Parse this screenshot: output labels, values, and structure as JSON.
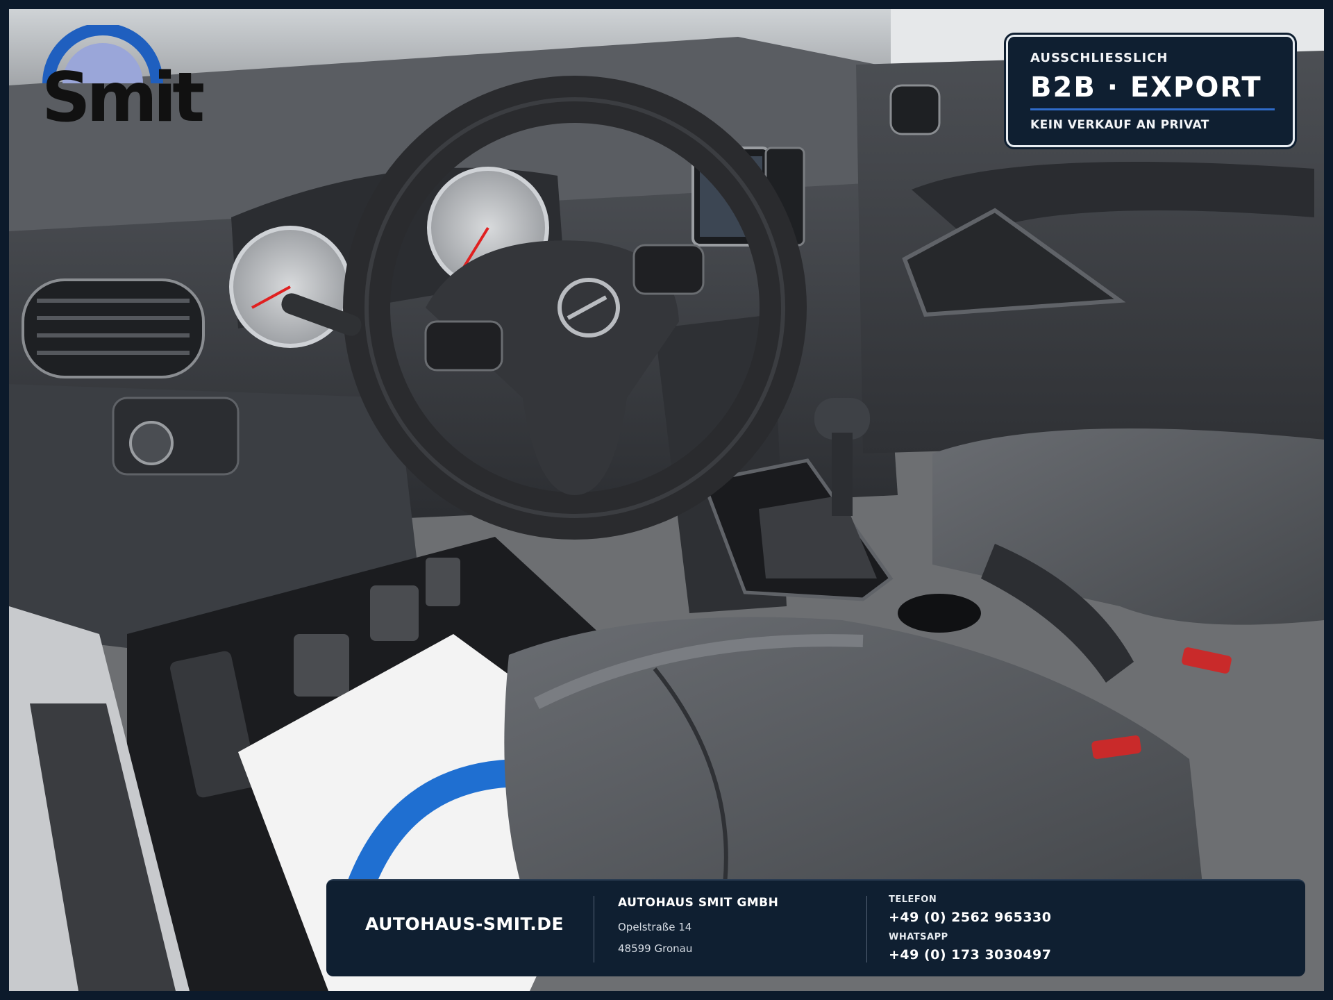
{
  "logo": {
    "text": "Smit",
    "arc_color": "#1f5fbf",
    "arc_inner_color": "#9aa6d9"
  },
  "badge": {
    "kicker": "AUSSCHLIESSLICH",
    "title": "B2B  ·  EXPORT",
    "subtitle": "KEIN VERKAUF AN PRIVAT",
    "accent": "#2f6bc8"
  },
  "footer": {
    "website": "AUTOHAUS-SMIT.DE",
    "company": "AUTOHAUS SMIT GMBH",
    "address_line1": "Opelstraße 14",
    "address_line2": "48599 Gronau",
    "phone_label": "TELEFON",
    "phone": "+49 (0) 2562 965330",
    "whatsapp_label": "WHATSAPP",
    "whatsapp": "+49 (0) 173 3030497"
  },
  "photo": {
    "subject": "car-interior-photo",
    "dashboard_color": "#3a3d42",
    "seat_color": "#55585d",
    "floor_mat_color": "#f2f2f2",
    "floor_mat_logo_color": "#1f6fd1"
  }
}
